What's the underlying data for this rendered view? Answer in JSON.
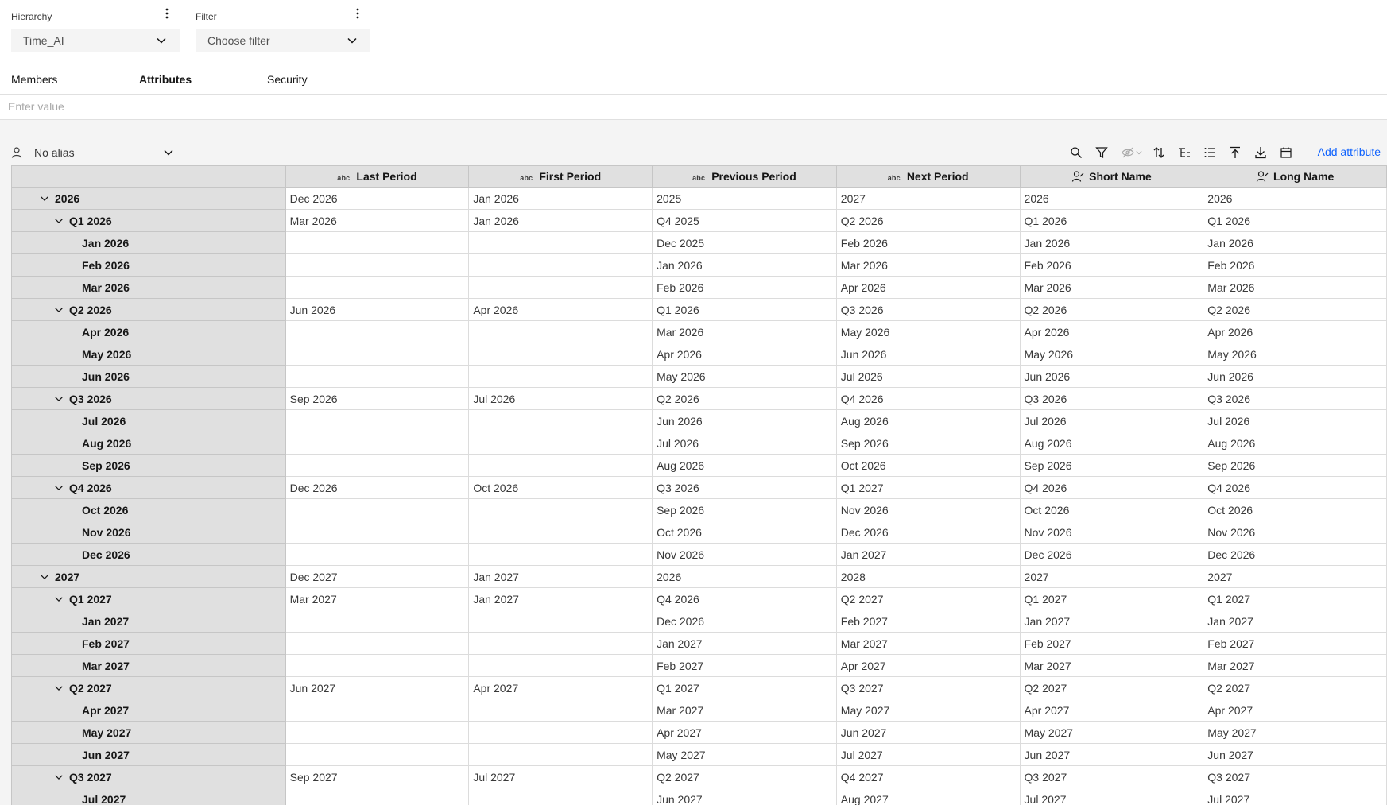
{
  "hierarchy": {
    "label": "Hierarchy",
    "value": "Time_AI"
  },
  "filter": {
    "label": "Filter",
    "placeholder": "Choose filter"
  },
  "tabs": [
    {
      "label": "Members"
    },
    {
      "label": "Attributes",
      "active": true
    },
    {
      "label": "Security"
    }
  ],
  "search": {
    "placeholder": "Enter value"
  },
  "alias": {
    "value": "No alias"
  },
  "toolbar": {
    "icons": [
      "search-icon",
      "filter-icon",
      "hide-icon",
      "sort-icon",
      "expand-tree-icon",
      "list-icon",
      "upload-icon",
      "download-icon",
      "calendar-icon"
    ],
    "add_attribute": "Add attribute"
  },
  "accent_color": "#0f62fe",
  "columns": [
    {
      "type": "abc",
      "label": "Last Period"
    },
    {
      "type": "abc",
      "label": "First Period"
    },
    {
      "type": "abc",
      "label": "Previous Period"
    },
    {
      "type": "abc",
      "label": "Next Period"
    },
    {
      "type": "alias",
      "label": "Short Name"
    },
    {
      "type": "alias",
      "label": "Long Name"
    }
  ],
  "rows": [
    {
      "level": 0,
      "expanded": true,
      "name": "2026",
      "cells": [
        "Dec 2026",
        "Jan 2026",
        "2025",
        "2027",
        "2026",
        "2026"
      ]
    },
    {
      "level": 1,
      "expanded": true,
      "name": "Q1 2026",
      "cells": [
        "Mar 2026",
        "Jan 2026",
        "Q4 2025",
        "Q2 2026",
        "Q1 2026",
        "Q1 2026"
      ]
    },
    {
      "level": 2,
      "name": "Jan 2026",
      "cells": [
        "",
        "",
        "Dec 2025",
        "Feb 2026",
        "Jan 2026",
        "Jan 2026"
      ]
    },
    {
      "level": 2,
      "name": "Feb 2026",
      "cells": [
        "",
        "",
        "Jan 2026",
        "Mar 2026",
        "Feb 2026",
        "Feb 2026"
      ]
    },
    {
      "level": 2,
      "name": "Mar 2026",
      "cells": [
        "",
        "",
        "Feb 2026",
        "Apr 2026",
        "Mar 2026",
        "Mar 2026"
      ]
    },
    {
      "level": 1,
      "expanded": true,
      "name": "Q2 2026",
      "cells": [
        "Jun 2026",
        "Apr 2026",
        "Q1 2026",
        "Q3 2026",
        "Q2 2026",
        "Q2 2026"
      ]
    },
    {
      "level": 2,
      "name": "Apr 2026",
      "cells": [
        "",
        "",
        "Mar 2026",
        "May 2026",
        "Apr 2026",
        "Apr 2026"
      ]
    },
    {
      "level": 2,
      "name": "May 2026",
      "cells": [
        "",
        "",
        "Apr 2026",
        "Jun 2026",
        "May 2026",
        "May 2026"
      ]
    },
    {
      "level": 2,
      "name": "Jun 2026",
      "cells": [
        "",
        "",
        "May 2026",
        "Jul 2026",
        "Jun 2026",
        "Jun 2026"
      ]
    },
    {
      "level": 1,
      "expanded": true,
      "name": "Q3 2026",
      "cells": [
        "Sep 2026",
        "Jul 2026",
        "Q2 2026",
        "Q4 2026",
        "Q3 2026",
        "Q3 2026"
      ]
    },
    {
      "level": 2,
      "name": "Jul 2026",
      "cells": [
        "",
        "",
        "Jun 2026",
        "Aug 2026",
        "Jul 2026",
        "Jul 2026"
      ]
    },
    {
      "level": 2,
      "name": "Aug 2026",
      "cells": [
        "",
        "",
        "Jul 2026",
        "Sep 2026",
        "Aug 2026",
        "Aug 2026"
      ]
    },
    {
      "level": 2,
      "name": "Sep 2026",
      "cells": [
        "",
        "",
        "Aug 2026",
        "Oct 2026",
        "Sep 2026",
        "Sep 2026"
      ]
    },
    {
      "level": 1,
      "expanded": true,
      "name": "Q4 2026",
      "cells": [
        "Dec 2026",
        "Oct 2026",
        "Q3 2026",
        "Q1 2027",
        "Q4 2026",
        "Q4 2026"
      ]
    },
    {
      "level": 2,
      "name": "Oct 2026",
      "cells": [
        "",
        "",
        "Sep 2026",
        "Nov 2026",
        "Oct 2026",
        "Oct 2026"
      ]
    },
    {
      "level": 2,
      "name": "Nov 2026",
      "cells": [
        "",
        "",
        "Oct 2026",
        "Dec 2026",
        "Nov 2026",
        "Nov 2026"
      ]
    },
    {
      "level": 2,
      "name": "Dec 2026",
      "cells": [
        "",
        "",
        "Nov 2026",
        "Jan 2027",
        "Dec 2026",
        "Dec 2026"
      ]
    },
    {
      "level": 0,
      "expanded": true,
      "name": "2027",
      "cells": [
        "Dec 2027",
        "Jan 2027",
        "2026",
        "2028",
        "2027",
        "2027"
      ]
    },
    {
      "level": 1,
      "expanded": true,
      "name": "Q1 2027",
      "cells": [
        "Mar 2027",
        "Jan 2027",
        "Q4 2026",
        "Q2 2027",
        "Q1 2027",
        "Q1 2027"
      ]
    },
    {
      "level": 2,
      "name": "Jan 2027",
      "cells": [
        "",
        "",
        "Dec 2026",
        "Feb 2027",
        "Jan 2027",
        "Jan 2027"
      ]
    },
    {
      "level": 2,
      "name": "Feb 2027",
      "cells": [
        "",
        "",
        "Jan 2027",
        "Mar 2027",
        "Feb 2027",
        "Feb 2027"
      ]
    },
    {
      "level": 2,
      "name": "Mar 2027",
      "cells": [
        "",
        "",
        "Feb 2027",
        "Apr 2027",
        "Mar 2027",
        "Mar 2027"
      ]
    },
    {
      "level": 1,
      "expanded": true,
      "name": "Q2 2027",
      "cells": [
        "Jun 2027",
        "Apr 2027",
        "Q1 2027",
        "Q3 2027",
        "Q2 2027",
        "Q2 2027"
      ]
    },
    {
      "level": 2,
      "name": "Apr 2027",
      "cells": [
        "",
        "",
        "Mar 2027",
        "May 2027",
        "Apr 2027",
        "Apr 2027"
      ]
    },
    {
      "level": 2,
      "name": "May 2027",
      "cells": [
        "",
        "",
        "Apr 2027",
        "Jun 2027",
        "May 2027",
        "May 2027"
      ]
    },
    {
      "level": 2,
      "name": "Jun 2027",
      "cells": [
        "",
        "",
        "May 2027",
        "Jul 2027",
        "Jun 2027",
        "Jun 2027"
      ]
    },
    {
      "level": 1,
      "expanded": true,
      "name": "Q3 2027",
      "cells": [
        "Sep 2027",
        "Jul 2027",
        "Q2 2027",
        "Q4 2027",
        "Q3 2027",
        "Q3 2027"
      ]
    },
    {
      "level": 2,
      "name": "Jul 2027",
      "cells": [
        "",
        "",
        "Jun 2027",
        "Aug 2027",
        "Jul 2027",
        "Jul 2027"
      ]
    }
  ]
}
